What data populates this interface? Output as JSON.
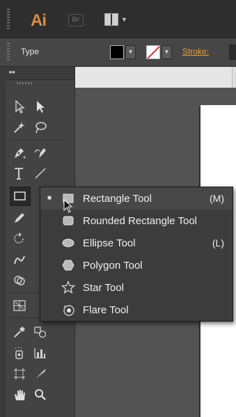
{
  "app": {
    "logo": "Ai",
    "bridge_logo": "Br"
  },
  "control_bar": {
    "mode_label": "Type",
    "stroke_label": "Stroke:"
  },
  "flyout": {
    "items": [
      {
        "label": "Rectangle Tool",
        "shortcut": "(M)",
        "checked": true
      },
      {
        "label": "Rounded Rectangle Tool",
        "shortcut": ""
      },
      {
        "label": "Ellipse Tool",
        "shortcut": "(L)"
      },
      {
        "label": "Polygon Tool",
        "shortcut": ""
      },
      {
        "label": "Star Tool",
        "shortcut": ""
      },
      {
        "label": "Flare Tool",
        "shortcut": ""
      }
    ],
    "check_mark": "■"
  },
  "colors": {
    "app_bg": "#2e2e2e",
    "ai_brand": "#d98c45",
    "stroke_label": "#e6a23c",
    "flyout_bg": "#3c3c3c",
    "flyout_active": "#474747"
  }
}
